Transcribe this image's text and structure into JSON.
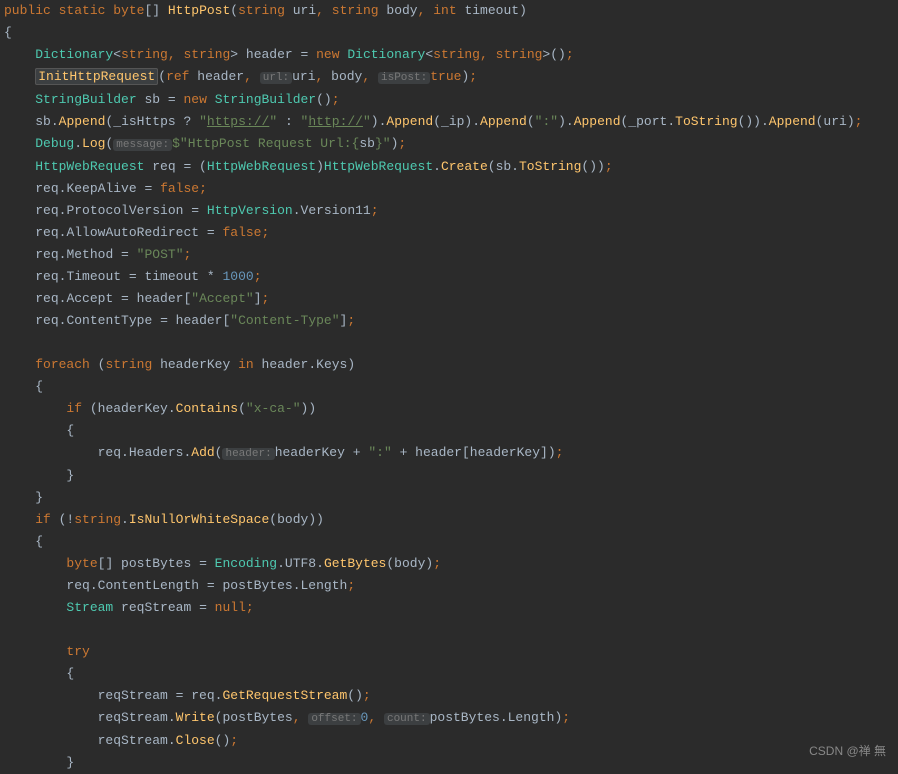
{
  "watermark": "CSDN @禅 無",
  "tokens": {
    "kw_public": "public",
    "kw_static": "static",
    "kw_byte": "byte",
    "kw_string": "string",
    "kw_int": "int",
    "kw_new": "new",
    "kw_ref": "ref",
    "kw_true": "true",
    "kw_false": "false",
    "kw_foreach": "foreach",
    "kw_in": "in",
    "kw_if": "if",
    "kw_null": "null",
    "kw_try": "try",
    "type_Dictionary": "Dictionary",
    "type_StringBuilder": "StringBuilder",
    "type_HttpWebRequest": "HttpWebRequest",
    "type_HttpVersion": "HttpVersion",
    "type_Encoding": "Encoding",
    "type_Stream": "Stream",
    "method_HttpPost": "HttpPost",
    "method_InitHttpRequest": "InitHttpRequest",
    "method_Append": "Append",
    "method_ToString": "ToString",
    "method_Log": "Log",
    "method_Create": "Create",
    "method_Contains": "Contains",
    "method_Add": "Add",
    "method_IsNullOrWhiteSpace": "IsNullOrWhiteSpace",
    "method_GetBytes": "GetBytes",
    "method_GetRequestStream": "GetRequestStream",
    "method_Write": "Write",
    "method_Close": "Close",
    "ident_uri": "uri",
    "ident_body": "body",
    "ident_timeout": "timeout",
    "ident_header": "header",
    "ident_sb": "sb",
    "ident_isHttps": "_isHttps",
    "ident_ip": "_ip",
    "ident_port": "_port",
    "ident_Debug": "Debug",
    "ident_req": "req",
    "ident_headerKey": "headerKey",
    "ident_postBytes": "postBytes",
    "ident_reqStream": "reqStream",
    "prop_KeepAlive": "KeepAlive",
    "prop_ProtocolVersion": "ProtocolVersion",
    "prop_Version11": "Version11",
    "prop_AllowAutoRedirect": "AllowAutoRedirect",
    "prop_Method": "Method",
    "prop_Timeout": "Timeout",
    "prop_Accept": "Accept",
    "prop_ContentType": "ContentType",
    "prop_Keys": "Keys",
    "prop_Headers": "Headers",
    "prop_UTF8": "UTF8",
    "prop_ContentLength": "ContentLength",
    "prop_Length": "Length",
    "str_https": "https://",
    "str_http": "http://",
    "str_colon": ":",
    "str_httppost": "HttpPost Request Url:{",
    "str_httppost_end": "}",
    "str_post": "POST",
    "str_accept": "Accept",
    "str_contenttype": "Content-Type",
    "str_xca": "x-ca-",
    "num_1000": "1000",
    "num_0": "0",
    "hint_url": "url:",
    "hint_isPost": "isPost:",
    "hint_message": "message:",
    "hint_header": "header:",
    "hint_offset": "offset:",
    "hint_count": "count:"
  }
}
